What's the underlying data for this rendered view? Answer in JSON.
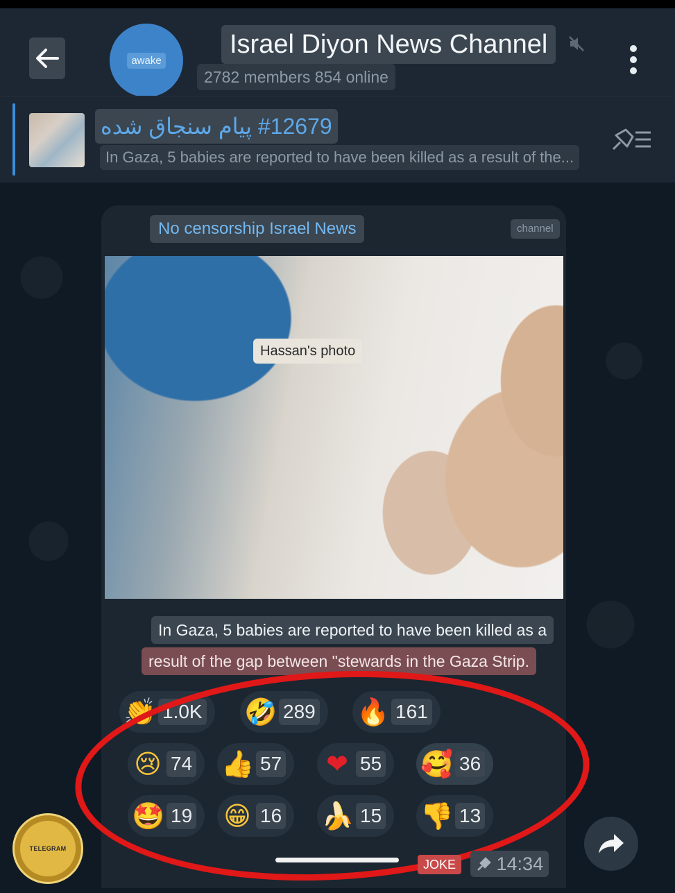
{
  "header": {
    "back_icon": "arrow-left-icon",
    "avatar_text": "awake",
    "title": "Israel Diyon News Channel",
    "members": "2782 members 854 online",
    "mute_icon": "muted-speaker-icon",
    "menu_icon": "vertical-dots-icon"
  },
  "pinned": {
    "title": "#12679 پیام سنجاق شده",
    "preview": "In Gaza, 5 babies are reported to have been killed as a result of the...",
    "list_icon": "pin-list-icon"
  },
  "message": {
    "forwarded_from": "No censorship Israel News",
    "channel_tag": "channel",
    "photo_caption": "Hassan's photo",
    "text_line1": "In Gaza, 5 babies are reported to have been killed as a",
    "text_line2": "result of the gap between \"stewards in the Gaza Strip.",
    "reactions": [
      {
        "emoji": "clap",
        "count": "1.0K"
      },
      {
        "emoji": "rofl",
        "count": "289"
      },
      {
        "emoji": "fire",
        "count": "161"
      },
      {
        "emoji": "cry",
        "count": "74"
      },
      {
        "emoji": "thumbs-up",
        "count": "57"
      },
      {
        "emoji": "heart",
        "count": "55"
      },
      {
        "emoji": "smiling-face-with-hearts",
        "count": "36"
      },
      {
        "emoji": "star-struck",
        "count": "19"
      },
      {
        "emoji": "grin",
        "count": "16"
      },
      {
        "emoji": "banana",
        "count": "15"
      },
      {
        "emoji": "thumbs-down",
        "count": "13"
      }
    ],
    "joke_tag": "JOKE",
    "time": "14:34"
  },
  "badge": {
    "line1": "TELEGRAM"
  },
  "colors": {
    "accent": "#3a8ed8",
    "highlight": "#e01818",
    "bubble": "#1b2630",
    "header": "#1c2733"
  }
}
